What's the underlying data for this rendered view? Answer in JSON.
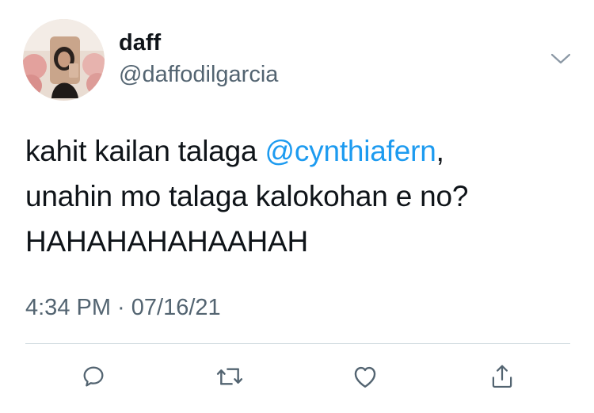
{
  "user": {
    "display_name": "daff",
    "handle": "@daffodilgarcia",
    "avatar_icon": "profile-photo"
  },
  "tweet": {
    "line1_prefix": "kahit kailan talaga ",
    "mention": "@cynthiafern",
    "line1_suffix": ",",
    "line2": "unahin mo talaga kalokohan e no?",
    "line3": "HAHAHAHAHAAHAH",
    "timestamp": "4:34 PM · 07/16/21"
  },
  "actions": [
    {
      "icon": "reply-icon"
    },
    {
      "icon": "retweet-icon"
    },
    {
      "icon": "like-icon"
    },
    {
      "icon": "share-icon"
    }
  ],
  "colors": {
    "text": "#0f1419",
    "secondary": "#536471",
    "link": "#1d9bf0",
    "divider": "#cfd9de"
  }
}
